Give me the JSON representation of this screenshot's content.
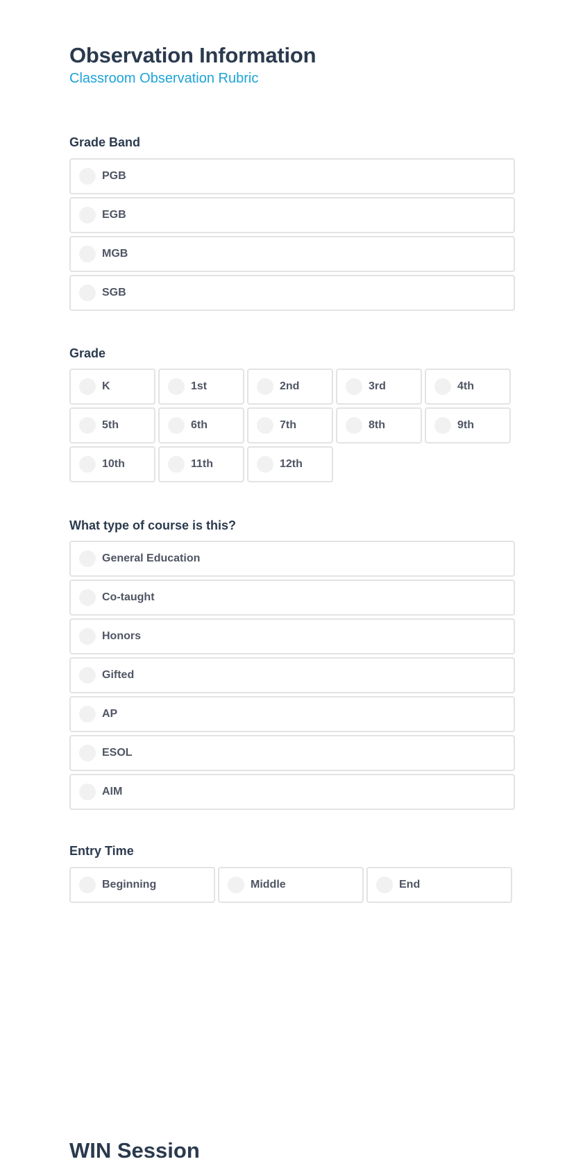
{
  "header": {
    "title": "Observation Information",
    "subtitle": "Classroom Observation Rubric"
  },
  "grade_band": {
    "label": "Grade Band",
    "options": [
      "PGB",
      "EGB",
      "MGB",
      "SGB"
    ]
  },
  "grade": {
    "label": "Grade",
    "options": [
      "K",
      "1st",
      "2nd",
      "3rd",
      "4th",
      "5th",
      "6th",
      "7th",
      "8th",
      "9th",
      "10th",
      "11th",
      "12th"
    ]
  },
  "course_type": {
    "label": "What type of course is this?",
    "options": [
      "General Education",
      "Co-taught",
      "Honors",
      "Gifted",
      "AP",
      "ESOL",
      "AIM"
    ]
  },
  "entry_time": {
    "label": "Entry Time",
    "options": [
      "Beginning",
      "Middle",
      "End"
    ]
  },
  "next_section": {
    "title": "WIN Session"
  },
  "colors": {
    "heading": "#2b3a4e",
    "accent": "#1ea3d8",
    "border": "#e3e3e3",
    "radio_fill": "#f1f1f1"
  }
}
